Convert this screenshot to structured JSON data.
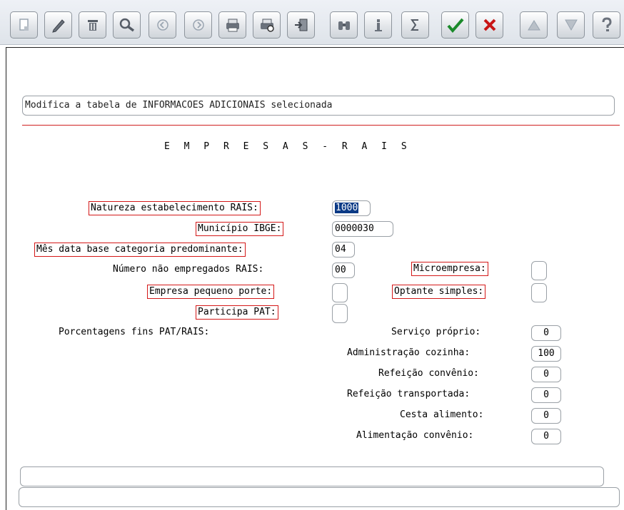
{
  "toolbar": {
    "buttons": [
      {
        "name": "new-record-icon",
        "color": "#9aa5b1"
      },
      {
        "name": "edit-pencil-icon",
        "color": "#555c66"
      },
      {
        "name": "delete-trash-icon",
        "color": "#555c66"
      },
      {
        "name": "search-magnifier-icon",
        "color": "#555c66"
      },
      {
        "name": "previous-icon",
        "color": "#9aa5b1"
      },
      {
        "name": "next-icon",
        "color": "#9aa5b1"
      },
      {
        "name": "print-icon",
        "color": "#555c66"
      },
      {
        "name": "print-preview-icon",
        "color": "#555c66"
      },
      {
        "name": "exit-door-icon",
        "color": "#555c66"
      },
      {
        "name": "binoculars-icon",
        "color": "#555c66"
      },
      {
        "name": "info-icon",
        "color": "#555c66"
      },
      {
        "name": "sum-icon",
        "color": "#555c66"
      },
      {
        "name": "confirm-check-icon",
        "color": "#1a8a2a"
      },
      {
        "name": "cancel-x-icon",
        "color": "#c81414"
      },
      {
        "name": "move-up-icon",
        "color": "#9aa5b1"
      },
      {
        "name": "move-down-icon",
        "color": "#9aa5b1"
      },
      {
        "name": "help-icon",
        "color": "#555c66"
      }
    ]
  },
  "status_message": "Modifica a tabela de INFORMACOES ADICIONAIS selecionada",
  "screen_title": "E M P R E S A S  -  R A I S",
  "form": {
    "natureza_label": "Natureza estabelecimento RAIS:",
    "natureza_value": "1000",
    "municipio_label": "Município IBGE:",
    "municipio_value": "0000030",
    "mes_label": "Mês data base categoria predominante:",
    "mes_value": "04",
    "nao_empregados_label": "Número não empregados RAIS:",
    "nao_empregados_value": "00",
    "microempresa_label": "Microempresa:",
    "microempresa_value": "",
    "pequeno_porte_label": "Empresa pequeno porte:",
    "pequeno_porte_value": "",
    "optante_label": "Optante simples:",
    "optante_value": "",
    "pat_label": "Participa PAT:",
    "pat_value": "",
    "porcentagens_label": "Porcentagens fins PAT/RAIS:"
  },
  "percentages": [
    {
      "label": "Serviço próprio:",
      "value": "0"
    },
    {
      "label": "Administração cozinha:",
      "value": "100"
    },
    {
      "label": "Refeição convênio:",
      "value": "0"
    },
    {
      "label": "Refeição transportada:",
      "value": "0"
    },
    {
      "label": "Cesta alimento:",
      "value": "0"
    },
    {
      "label": "Alimentação convênio:",
      "value": "0"
    }
  ],
  "bottom": {
    "message_line_1": "",
    "message_line_2": ""
  },
  "colors": {
    "highlight_border": "#d41818",
    "selection_bg": "#0b3a86",
    "separator": "#d02020"
  }
}
